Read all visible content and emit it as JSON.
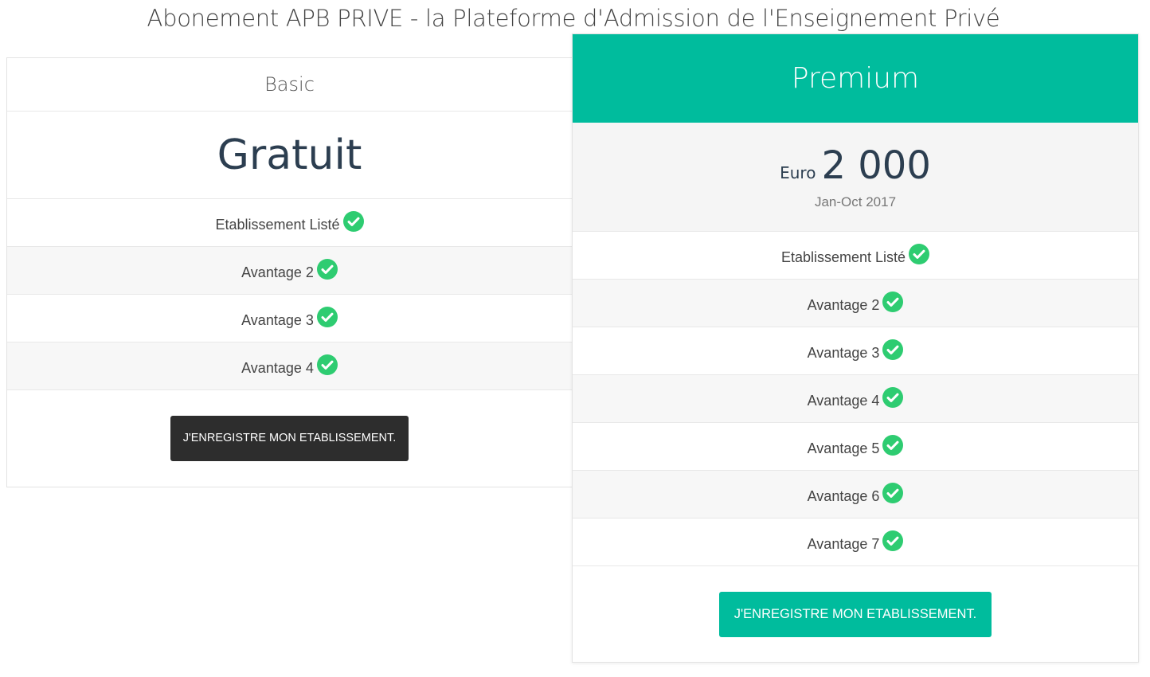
{
  "page": {
    "title": "Abonement APB PRIVE - la Plateforme d'Admission de l'Enseignement Privé"
  },
  "plans": {
    "basic": {
      "name": "Basic",
      "price": "Gratuit",
      "features": [
        {
          "label": "Etablissement Listé",
          "icon": "check-circle-icon"
        },
        {
          "label": "Avantage 2",
          "icon": "check-circle-icon"
        },
        {
          "label": "Avantage 3",
          "icon": "check-circle-icon"
        },
        {
          "label": "Avantage 4",
          "icon": "check-circle-icon"
        }
      ],
      "cta_label": "J'ENREGISTRE MON ETABLISSEMENT."
    },
    "premium": {
      "name": "Premium",
      "currency": "Euro",
      "amount": "2 000",
      "period": "Jan-Oct 2017",
      "features": [
        {
          "label": "Etablissement Listé",
          "icon": "check-circle-icon"
        },
        {
          "label": "Avantage 2",
          "icon": "check-circle-icon"
        },
        {
          "label": "Avantage 3",
          "icon": "check-circle-icon"
        },
        {
          "label": "Avantage 4",
          "icon": "check-circle-icon"
        },
        {
          "label": "Avantage 5",
          "icon": "check-circle-icon"
        },
        {
          "label": "Avantage 6",
          "icon": "check-circle-icon"
        },
        {
          "label": "Avantage 7",
          "icon": "check-circle-icon"
        }
      ],
      "cta_label": "J'ENREGISTRE MON ETABLISSEMENT."
    }
  },
  "colors": {
    "accent": "#00bc9d",
    "check": "#2ecc71",
    "dark_button": "#2d2d2d",
    "price_text": "#2c3e50"
  }
}
